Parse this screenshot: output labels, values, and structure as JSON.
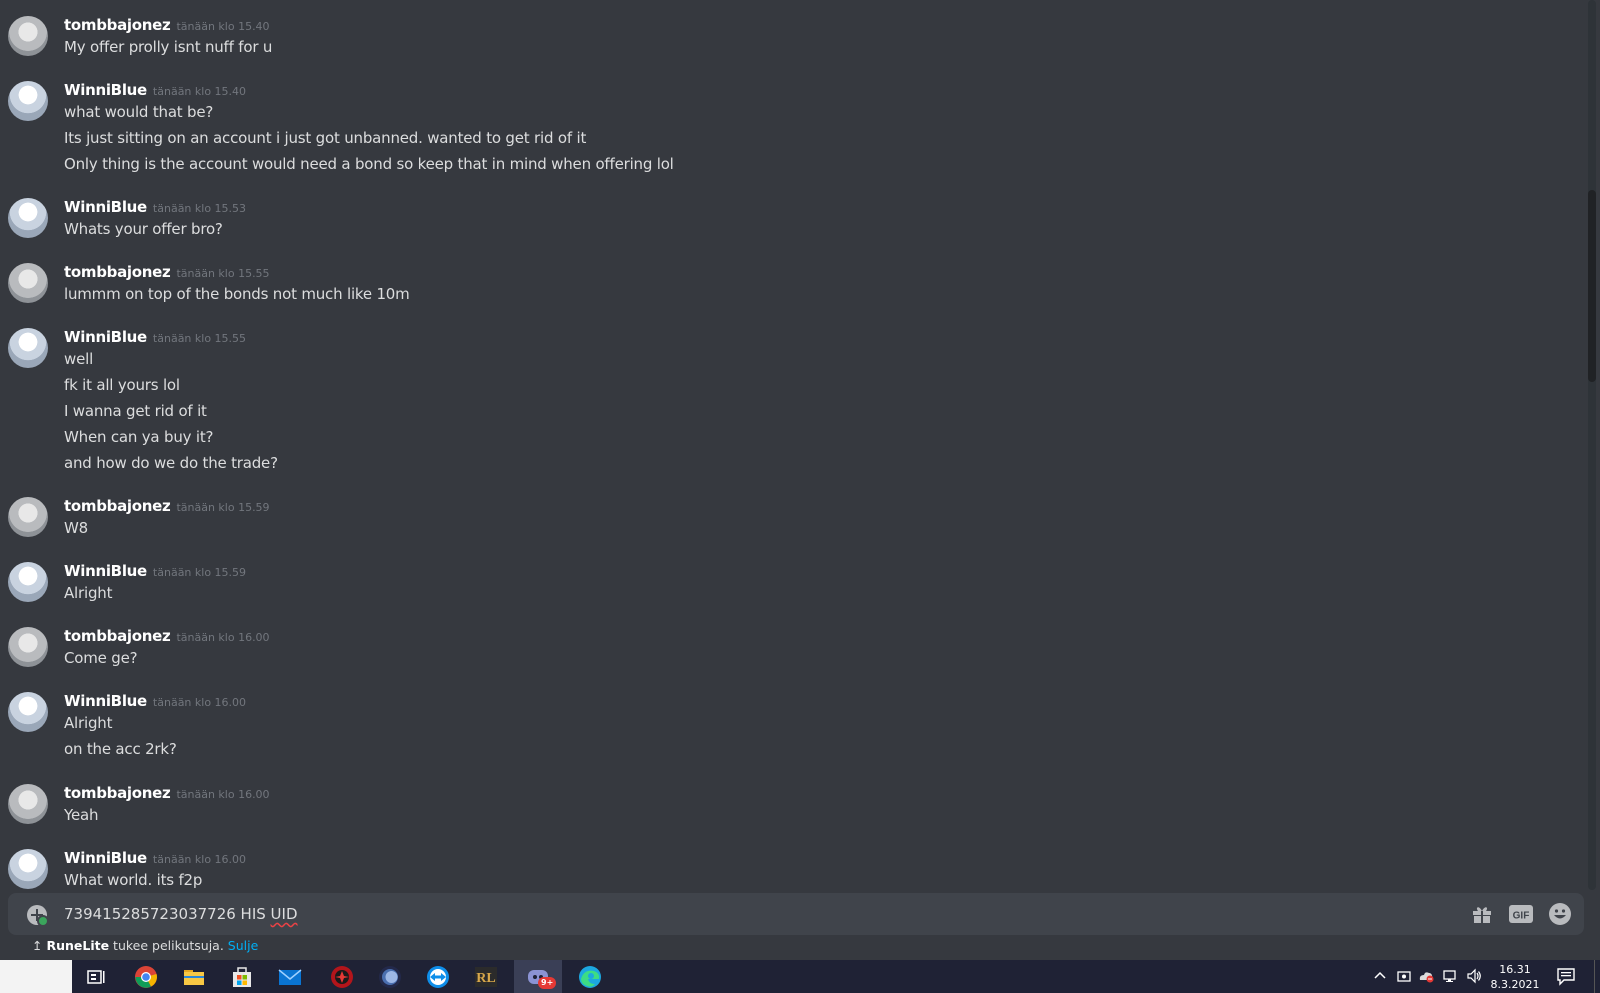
{
  "messages": [
    {
      "author": "tombbajonez",
      "timestamp": "tänään klo 15.40",
      "lines": [
        "My offer prolly isnt nuff for u"
      ]
    },
    {
      "author": "WinniBlue",
      "timestamp": "tänään klo 15.40",
      "lines": [
        "what would that be?",
        "Its just sitting on an account i just got unbanned. wanted to get rid of it",
        "Only thing is the account would need a bond so keep that in mind when offering lol"
      ]
    },
    {
      "author": "WinniBlue",
      "timestamp": "tänään klo 15.53",
      "lines": [
        "Whats your offer bro?"
      ]
    },
    {
      "author": "tombbajonez",
      "timestamp": "tänään klo 15.55",
      "lines": [
        "lummm on top of the bonds not much like 10m"
      ]
    },
    {
      "author": "WinniBlue",
      "timestamp": "tänään klo 15.55",
      "lines": [
        "well",
        "fk it all yours lol",
        "I wanna get rid of it",
        "When can ya buy it?",
        "and how do we do the trade?"
      ]
    },
    {
      "author": "tombbajonez",
      "timestamp": "tänään klo 15.59",
      "lines": [
        "W8"
      ]
    },
    {
      "author": "WinniBlue",
      "timestamp": "tänään klo 15.59",
      "lines": [
        "Alright"
      ]
    },
    {
      "author": "tombbajonez",
      "timestamp": "tänään klo 16.00",
      "lines": [
        "Come ge?"
      ]
    },
    {
      "author": "WinniBlue",
      "timestamp": "tänään klo 16.00",
      "lines": [
        "Alright",
        "on the acc 2rk?"
      ]
    },
    {
      "author": "tombbajonez",
      "timestamp": "tänään klo 16.00",
      "lines": [
        "Yeah"
      ]
    },
    {
      "author": "WinniBlue",
      "timestamp": "tänään klo 16.00",
      "lines": [
        "What world. its f2p"
      ]
    }
  ],
  "composer": {
    "value_prefix": "739415285723037726 HIS ",
    "value_misspelled": "UID",
    "icons": [
      "attach-icon",
      "gift-icon",
      "gif-icon",
      "emoji-icon"
    ],
    "gif_label": "GIF"
  },
  "invite_bar": {
    "app": "RuneLite",
    "text": " tukee pelikutsuja. ",
    "close": "Sulje"
  },
  "taskbar": {
    "apps": [
      "task-view-icon",
      "chrome-icon",
      "file-explorer-icon",
      "store-icon",
      "mail-icon",
      "red-app-icon",
      "blue-circle-app-icon",
      "teamviewer-icon",
      "runelite-icon",
      "discord-icon",
      "edge-icon"
    ],
    "discord_badge": "9+",
    "time": "16.31",
    "date": "8.3.2021"
  },
  "colors": {
    "background": "#36393f",
    "input": "#40444b",
    "taskbar": "#1f2235",
    "link": "#00aff4"
  }
}
